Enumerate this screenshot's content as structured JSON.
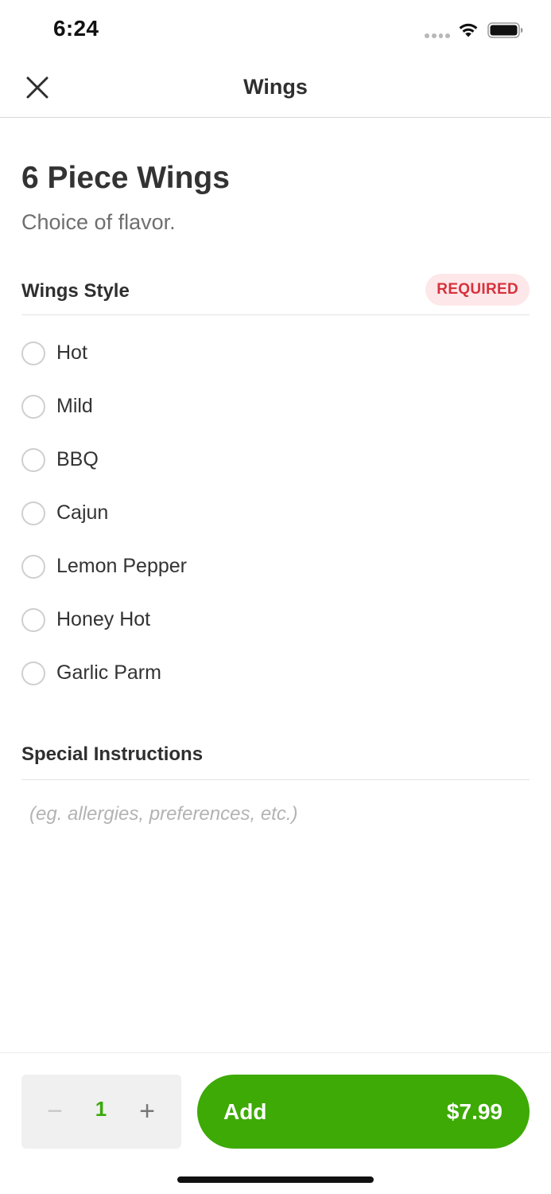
{
  "status_bar": {
    "time": "6:24",
    "icons": [
      "signal-dots-icon",
      "wifi-icon",
      "battery-icon"
    ]
  },
  "nav": {
    "title": "Wings",
    "close_icon": "close-icon"
  },
  "item": {
    "title": "6 Piece Wings",
    "description": "Choice of flavor."
  },
  "wings_style": {
    "title": "Wings Style",
    "badge": "REQUIRED",
    "options": [
      {
        "label": "Hot",
        "selected": false
      },
      {
        "label": "Mild",
        "selected": false
      },
      {
        "label": "BBQ",
        "selected": false
      },
      {
        "label": "Cajun",
        "selected": false
      },
      {
        "label": "Lemon Pepper",
        "selected": false
      },
      {
        "label": "Honey Hot",
        "selected": false
      },
      {
        "label": "Garlic Parm",
        "selected": false
      }
    ]
  },
  "special_instructions": {
    "title": "Special Instructions",
    "value": "",
    "placeholder": "(eg. allergies, preferences, etc.)"
  },
  "footer": {
    "quantity": "1",
    "minus_symbol": "−",
    "plus_symbol": "+",
    "add_label": "Add",
    "price": "$7.99"
  },
  "colors": {
    "accent_green": "#3daa06",
    "required_red": "#d7323d",
    "required_bg": "#fde7e9"
  }
}
